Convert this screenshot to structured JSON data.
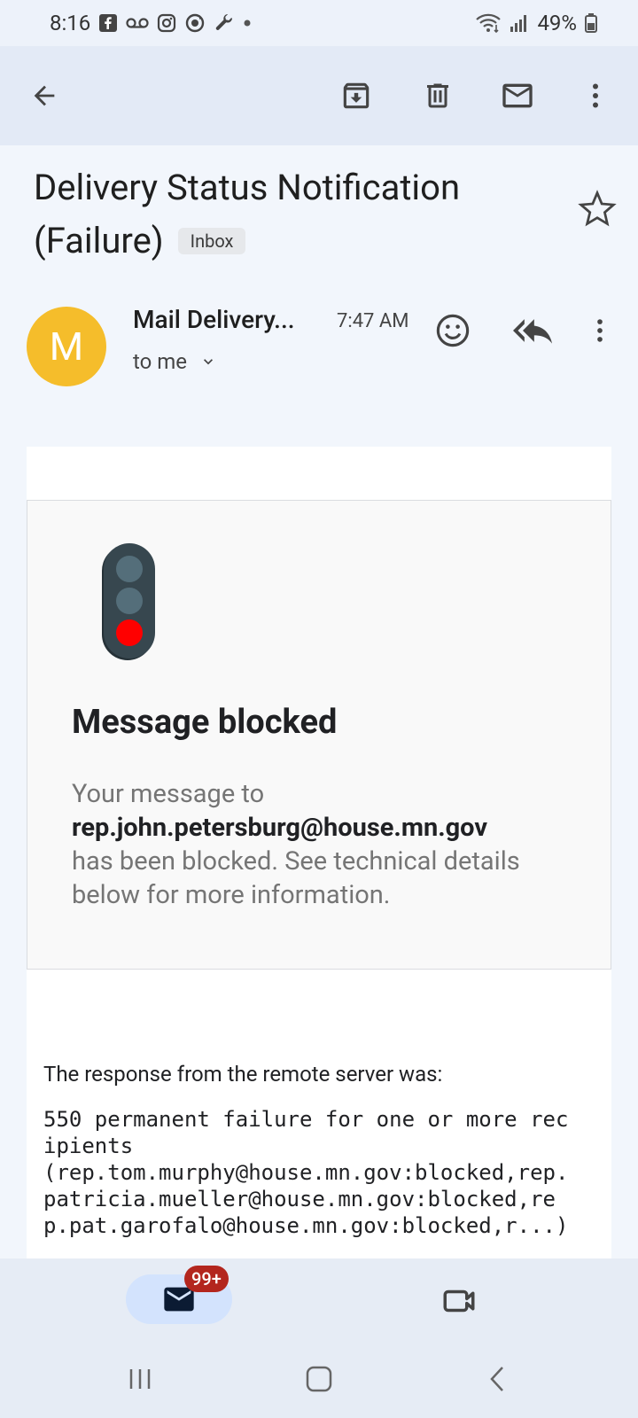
{
  "status_bar": {
    "time": "8:16",
    "battery": "49%",
    "left_icons": [
      "facebook-icon",
      "voicemail-icon",
      "instagram-icon",
      "sync-icon",
      "wrench-icon",
      "dot-icon"
    ],
    "right_icons": [
      "wifi-icon",
      "signal-icon",
      "battery-icon"
    ]
  },
  "toolbar": {
    "back": "back-arrow-icon",
    "actions": [
      "archive-icon",
      "delete-icon",
      "mark-unread-icon",
      "more-vert-icon"
    ]
  },
  "email": {
    "subject": "Delivery Status Notification (Failure)",
    "label": "Inbox",
    "sender_initial": "M",
    "sender": "Mail Delivery...",
    "time": "7:47 AM",
    "recipient": "to me",
    "avatar_color": "#f5bd2b"
  },
  "notice": {
    "title": "Message blocked",
    "intro": "Your message to",
    "address": "rep.john.petersburg@house.mn.gov",
    "details": "has been blocked. See technical details below for more information."
  },
  "body": {
    "response_label": "The response from the remote server was:",
    "response_text": "550 permanent failure for one or more recipients\n(rep.tom.murphy@house.mn.gov:blocked,rep.patricia.mueller@house.mn.gov:blocked,rep.pat.garofalo@house.mn.gov:blocked,r...)"
  },
  "bottom_nav": {
    "mail_badge": "99+",
    "items": [
      "mail-icon",
      "meet-video-icon"
    ]
  },
  "colors": {
    "accent": "#d3e3fd",
    "badge_red": "#b3261e",
    "light_red": "#ff0000"
  }
}
